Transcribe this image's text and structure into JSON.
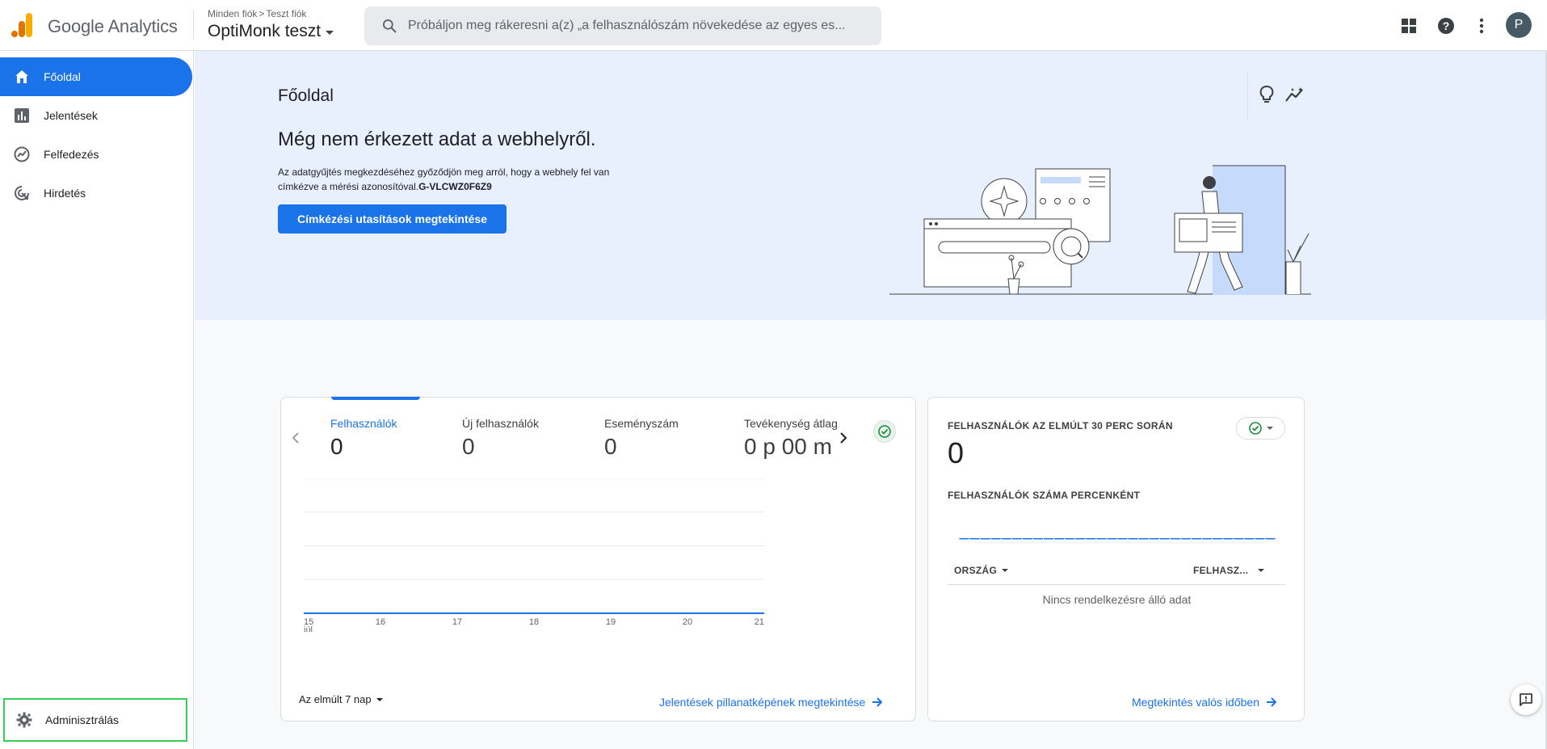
{
  "header": {
    "product_name": "Google Analytics",
    "breadcrumb": [
      "Minden fiók",
      "Teszt fiók"
    ],
    "breadcrumb_separator": ">",
    "property_name": "OptiMonk teszt",
    "search_placeholder": "Próbáljon meg rákeresni a(z) „a felhasználószám növekedése az egyes es...",
    "avatar_initial": "P",
    "icons": [
      "apps-icon",
      "help-icon",
      "more-vert-icon"
    ]
  },
  "sidebar": {
    "items": [
      {
        "label": "Főoldal",
        "icon": "home-icon",
        "active": true
      },
      {
        "label": "Jelentések",
        "icon": "bar-chart-icon",
        "active": false
      },
      {
        "label": "Felfedezés",
        "icon": "explore-icon",
        "active": false
      },
      {
        "label": "Hirdetés",
        "icon": "advertising-icon",
        "active": false
      }
    ],
    "admin_label": "Adminisztrálás"
  },
  "hero": {
    "page_title": "Főoldal",
    "heading": "Még nem érkezett adat a webhelyről.",
    "description": "Az adatgyűjtés megkezdéséhez győződjön meg arról, hogy a webhely fel van címkézve a mérési azonosítóval.",
    "measurement_id": "G-VLCWZ0F6Z9",
    "button_label": "Címkézési utasítások megtekintése"
  },
  "metrics_card": {
    "metrics": [
      {
        "label": "Felhasználók",
        "value": "0",
        "active": true
      },
      {
        "label": "Új felhasználók",
        "value": "0",
        "active": false
      },
      {
        "label": "Eseményszám",
        "value": "0",
        "active": false
      },
      {
        "label": "Tevékenység átlag",
        "value": "0 p 00 m",
        "active": false
      }
    ],
    "date_range_label": "Az elmúlt 7 nap",
    "link_label": "Jelentések pillanatképének megtekintése"
  },
  "chart_data": {
    "type": "line",
    "categories": [
      "15",
      "16",
      "17",
      "18",
      "19",
      "20",
      "21"
    ],
    "category_sublabels": [
      "júl.",
      "",
      "",
      "",
      "",
      "",
      ""
    ],
    "series": [
      {
        "values": [
          0,
          0,
          0,
          0,
          0,
          0,
          0
        ],
        "color": "#1a73e8"
      }
    ],
    "xlabel": "",
    "ylabel": "",
    "grid": true,
    "legend": "none"
  },
  "realtime_card": {
    "title": "FELHASZNÁLÓK AZ ELMÚLT 30 PERC SORÁN",
    "value": "0",
    "subtitle": "FELHASZNÁLÓK SZÁMA PERCENKÉNT",
    "minute_bars": 30,
    "col_country": "ORSZÁG",
    "col_users": "FELHASZ...",
    "empty_text": "Nincs rendelkezésre álló adat",
    "link_label": "Megtekintés valós időben"
  },
  "colors": {
    "accent": "#1a73e8",
    "hero_bg": "#e8f0fe",
    "success": "#1e8e3e",
    "admin_highlight": "#34d058"
  }
}
